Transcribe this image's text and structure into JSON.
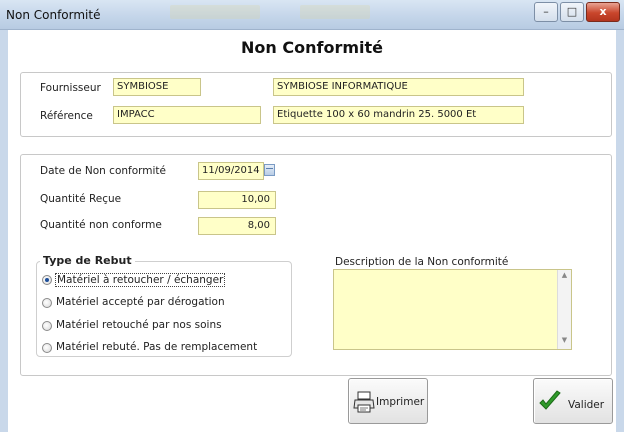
{
  "window": {
    "title": "Non Conformité",
    "controls": {
      "minimize": "–",
      "maximize": "□",
      "close": "x"
    }
  },
  "form": {
    "heading": "Non Conformité",
    "fournisseur": {
      "label": "Fournisseur",
      "code": "SYMBIOSE",
      "name": "SYMBIOSE INFORMATIQUE"
    },
    "reference": {
      "label": "Référence",
      "code": "IMPACC",
      "description": "Etiquette 100 x 60 mandrin 25.  5000 Et"
    },
    "date_nc": {
      "label": "Date de Non conformité",
      "value": "11/09/2014"
    },
    "qte_recue": {
      "label": "Quantité Reçue",
      "value": "10,00"
    },
    "qte_nc": {
      "label": "Quantité non conforme",
      "value": "8,00"
    },
    "type_rebut": {
      "title": "Type de Rebut",
      "options": [
        {
          "label": "Matériel à retoucher / échanger",
          "selected": true
        },
        {
          "label": "Matériel accepté par dérogation",
          "selected": false
        },
        {
          "label": "Matériel retouché par nos soins",
          "selected": false
        },
        {
          "label": "Matériel rebuté. Pas de remplacement",
          "selected": false
        }
      ]
    },
    "description": {
      "label": "Description de la Non conformité",
      "value": ""
    }
  },
  "actions": {
    "print_label": "Imprimer",
    "validate_label": "Valider"
  },
  "colors": {
    "field_bg": "#ffffc8",
    "titlebar": "#c5d6ea",
    "close_button": "#c9462c",
    "check_green": "#2f9a2a"
  }
}
